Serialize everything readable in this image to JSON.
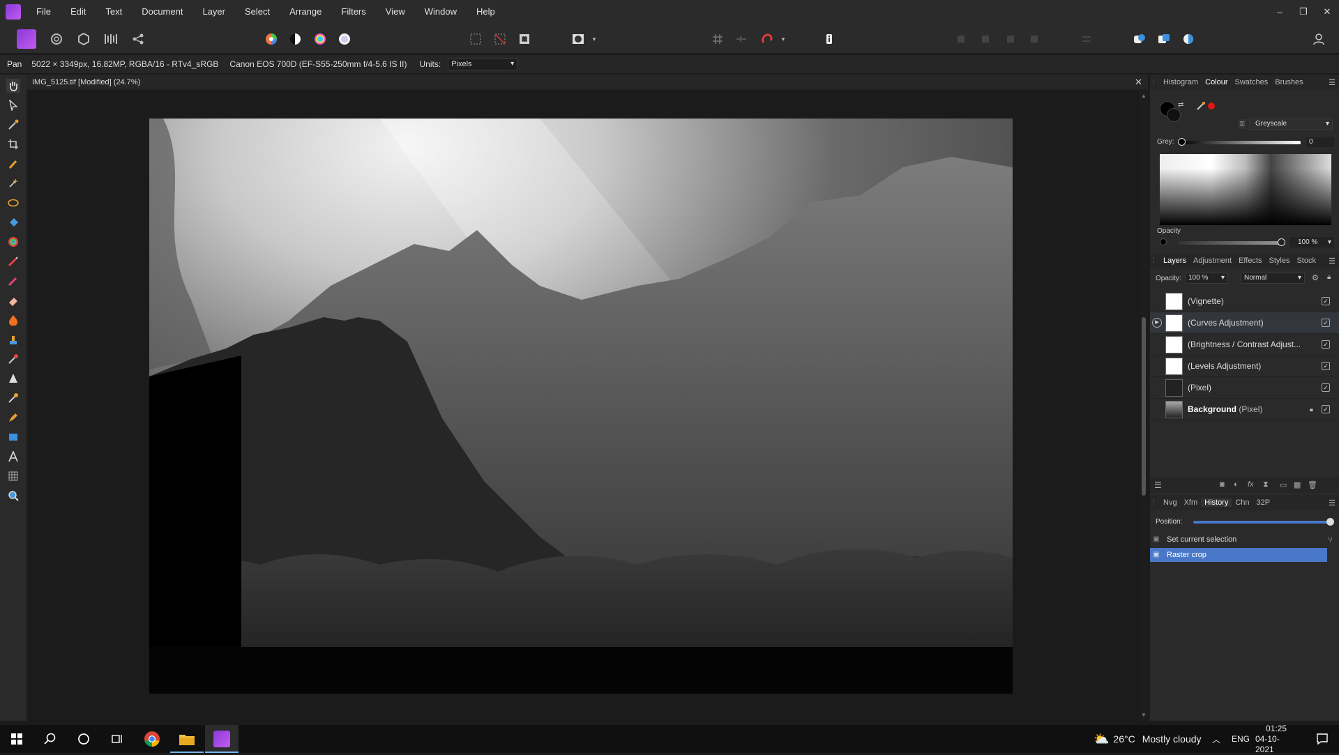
{
  "menubar": {
    "items": [
      "File",
      "Edit",
      "Text",
      "Document",
      "Layer",
      "Select",
      "Arrange",
      "Filters",
      "View",
      "Window",
      "Help"
    ]
  },
  "context": {
    "tool": "Pan",
    "info": "5022 × 3349px, 16.82MP, RGBA/16 - RTv4_sRGB",
    "camera": "Canon EOS 700D (EF-S55-250mm f/4-5.6 IS II)",
    "units_label": "Units:",
    "units_value": "Pixels"
  },
  "document": {
    "tab_title": "IMG_5125.tif [Modified] (24.7%)"
  },
  "colour_panel": {
    "tabs": [
      "Histogram",
      "Colour",
      "Swatches",
      "Brushes"
    ],
    "active_tab": "Colour",
    "mode": "Greyscale",
    "grey_label": "Grey:",
    "grey_value": "0",
    "opacity_label": "Opacity",
    "opacity_value": "100 %"
  },
  "layers_panel": {
    "tabs": [
      "Layers",
      "Adjustment",
      "Effects",
      "Styles",
      "Stock"
    ],
    "active_tab": "Layers",
    "opacity_label": "Opacity:",
    "opacity_value": "100 %",
    "blend_mode": "Normal",
    "layers": [
      {
        "name": "(Vignette)",
        "type": ""
      },
      {
        "name": "(Curves Adjustment)",
        "type": ""
      },
      {
        "name": "(Brightness / Contrast Adjust...",
        "type": ""
      },
      {
        "name": "(Levels Adjustment)",
        "type": ""
      },
      {
        "name": "(Pixel)",
        "type": ""
      },
      {
        "name": "Background",
        "type": "(Pixel)"
      }
    ]
  },
  "history_panel": {
    "tabs": [
      "Nvg",
      "Xfm",
      "History",
      "Chn",
      "32P"
    ],
    "active_tab": "History",
    "position_label": "Position:",
    "items": [
      "Set current selection",
      "Raster crop"
    ],
    "selected_index": 1
  },
  "taskbar": {
    "temperature": "26°C",
    "weather": "Mostly cloudy",
    "language": "ENG",
    "time": "01:25",
    "date": "04-10-2021"
  },
  "colors": {
    "accent": "#4a78c8",
    "affinity": "#a74ae0",
    "panel": "#2a2a2a"
  }
}
